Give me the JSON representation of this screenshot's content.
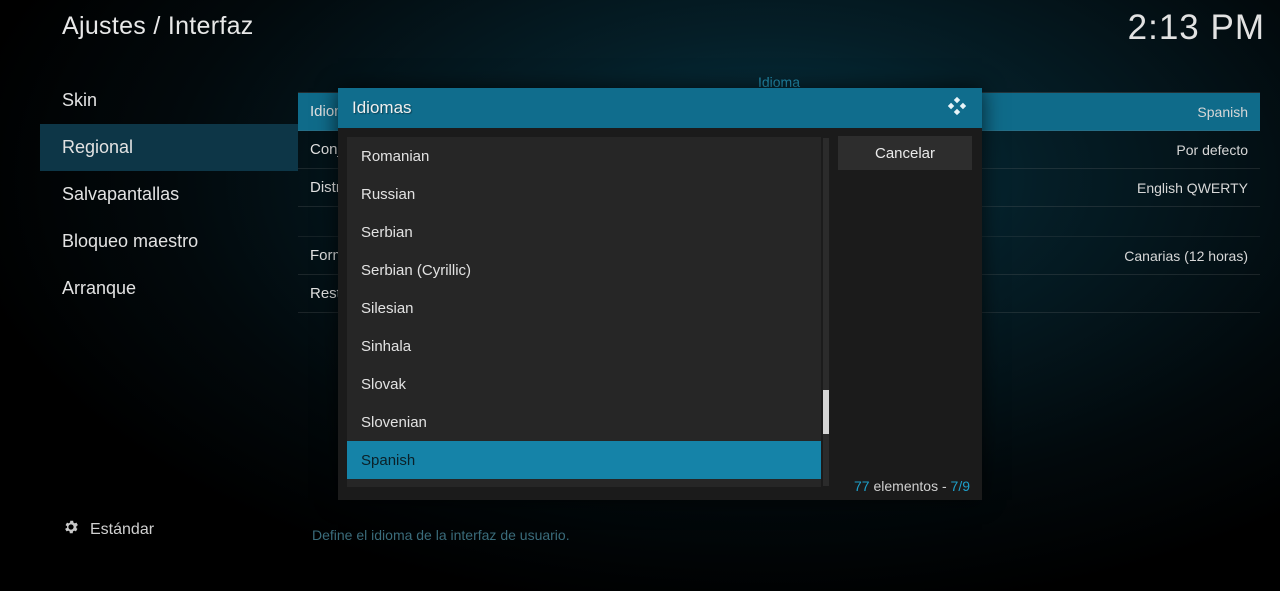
{
  "header": {
    "breadcrumb": "Ajustes / Interfaz",
    "time": "2:13 PM"
  },
  "sidebar": {
    "items": [
      {
        "label": "Skin",
        "selected": false
      },
      {
        "label": "Regional",
        "selected": true
      },
      {
        "label": "Salvapantallas",
        "selected": false
      },
      {
        "label": "Bloqueo maestro",
        "selected": false
      },
      {
        "label": "Arranque",
        "selected": false
      }
    ]
  },
  "main": {
    "section": "Idioma",
    "rows": [
      {
        "label": "Idioma",
        "value": "Spanish",
        "highlight": true
      },
      {
        "label": "Conjunto de caracteres",
        "value": "Por defecto",
        "highlight": false
      },
      {
        "label": "Distribución del teclado",
        "value": "English QWERTY",
        "highlight": false
      }
    ],
    "section2": "",
    "rows2": [
      {
        "label": "Formato de región por defecto",
        "value": "Canarias (12 horas)"
      },
      {
        "label": "Restablecer todos los formatos anteriores",
        "value": ""
      }
    ]
  },
  "modal": {
    "title": "Idiomas",
    "languages": [
      "Romanian",
      "Russian",
      "Serbian",
      "Serbian (Cyrillic)",
      "Silesian",
      "Sinhala",
      "Slovak",
      "Slovenian",
      "Spanish"
    ],
    "cancel": "Cancelar",
    "count": "77",
    "count_label": "elementos",
    "page": "7/9"
  },
  "footer": {
    "level": "Estándar",
    "help": "Define el idioma de la interfaz de usuario."
  }
}
